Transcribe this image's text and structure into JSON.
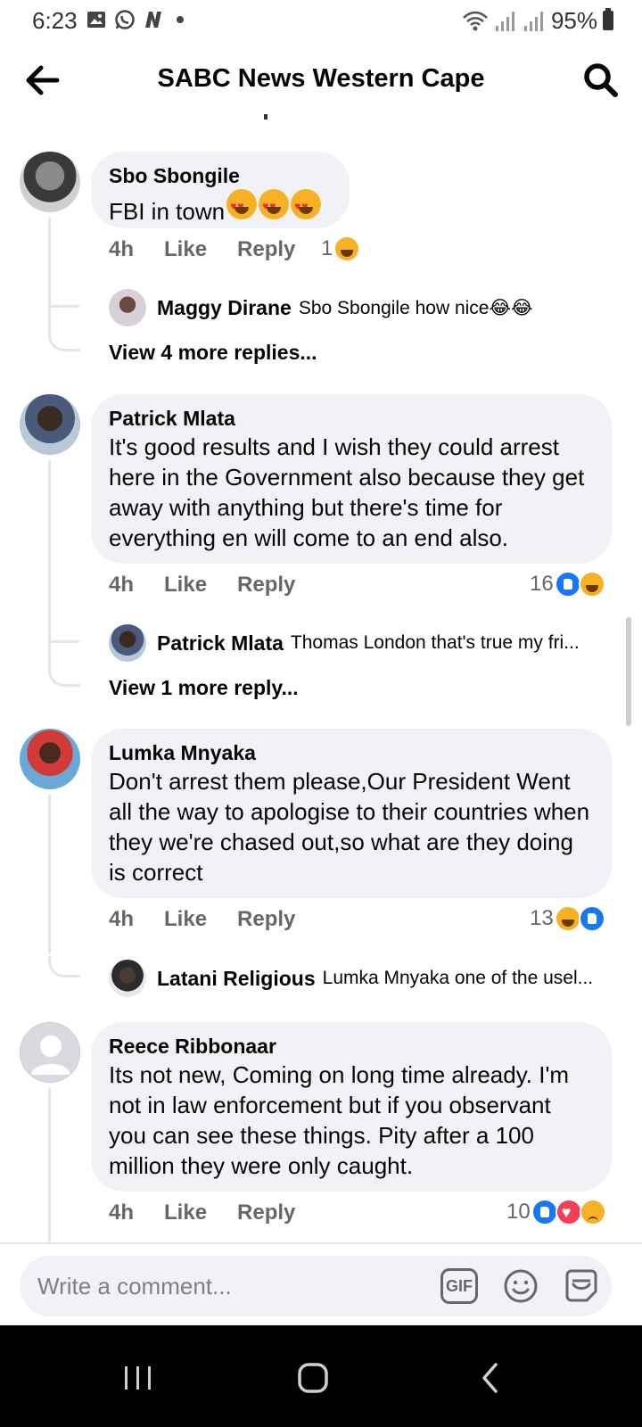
{
  "status_bar": {
    "time": "6:23",
    "battery_percent": "95%",
    "left_icons": [
      "gallery-icon",
      "whatsapp-icon",
      "news-icon",
      "dot-icon"
    ],
    "right_icons": [
      "wifi-icon",
      "signal-icon",
      "signal-icon",
      "battery-icon"
    ]
  },
  "header": {
    "title": "SABC News Western Cape",
    "back_icon": "arrow-left-icon",
    "search_icon": "search-icon"
  },
  "comments": [
    {
      "author": "Sbo Sbongile",
      "text": "FBI in town",
      "time": "4h",
      "like_label": "Like",
      "reply_label": "Reply",
      "reaction_count": "1",
      "reactions": [
        "laughing"
      ],
      "replies": [
        {
          "author": "Maggy Dirane",
          "text": "Sbo Sbongile how nice😂😂"
        }
      ],
      "view_more": "View 4 more replies..."
    },
    {
      "author": "Patrick Mlata",
      "text": "It's good results and I wish they could arrest here in the Government also because they get away with anything but there's time for everything en will come to an end also.",
      "time": "4h",
      "like_label": "Like",
      "reply_label": "Reply",
      "reaction_count": "16",
      "reactions": [
        "like",
        "laughing"
      ],
      "replies": [
        {
          "author": "Patrick Mlata",
          "text": "Thomas London that's true my fri..."
        }
      ],
      "view_more": "View 1 more reply..."
    },
    {
      "author": "Lumka Mnyaka",
      "text": "Don't arrest them please,Our President Went all the way to  apologise to their countries when they we're chased out,so what are they doing is correct",
      "time": "4h",
      "like_label": "Like",
      "reply_label": "Reply",
      "reaction_count": "13",
      "reactions": [
        "laughing",
        "like"
      ],
      "replies": [
        {
          "author": "Latani Religious",
          "text": "Lumka Mnyaka one of the usel..."
        }
      ]
    },
    {
      "author": "Reece Ribbonaar",
      "text": "Its not new, Coming on long time already. I'm not in law enforcement but if you observant you can see these things. Pity after a 100 million they were only caught.",
      "time": "4h",
      "like_label": "Like",
      "reply_label": "Reply",
      "reaction_count": "10",
      "reactions": [
        "like",
        "love",
        "sad"
      ]
    }
  ],
  "composer": {
    "placeholder": "Write a comment...",
    "gif_label": "GIF",
    "emoji_icon": "smiley-icon",
    "sticker_icon": "sticker-icon"
  },
  "nav": {
    "recent_icon": "recent-apps-icon",
    "home_icon": "home-icon",
    "back_icon": "back-icon"
  }
}
